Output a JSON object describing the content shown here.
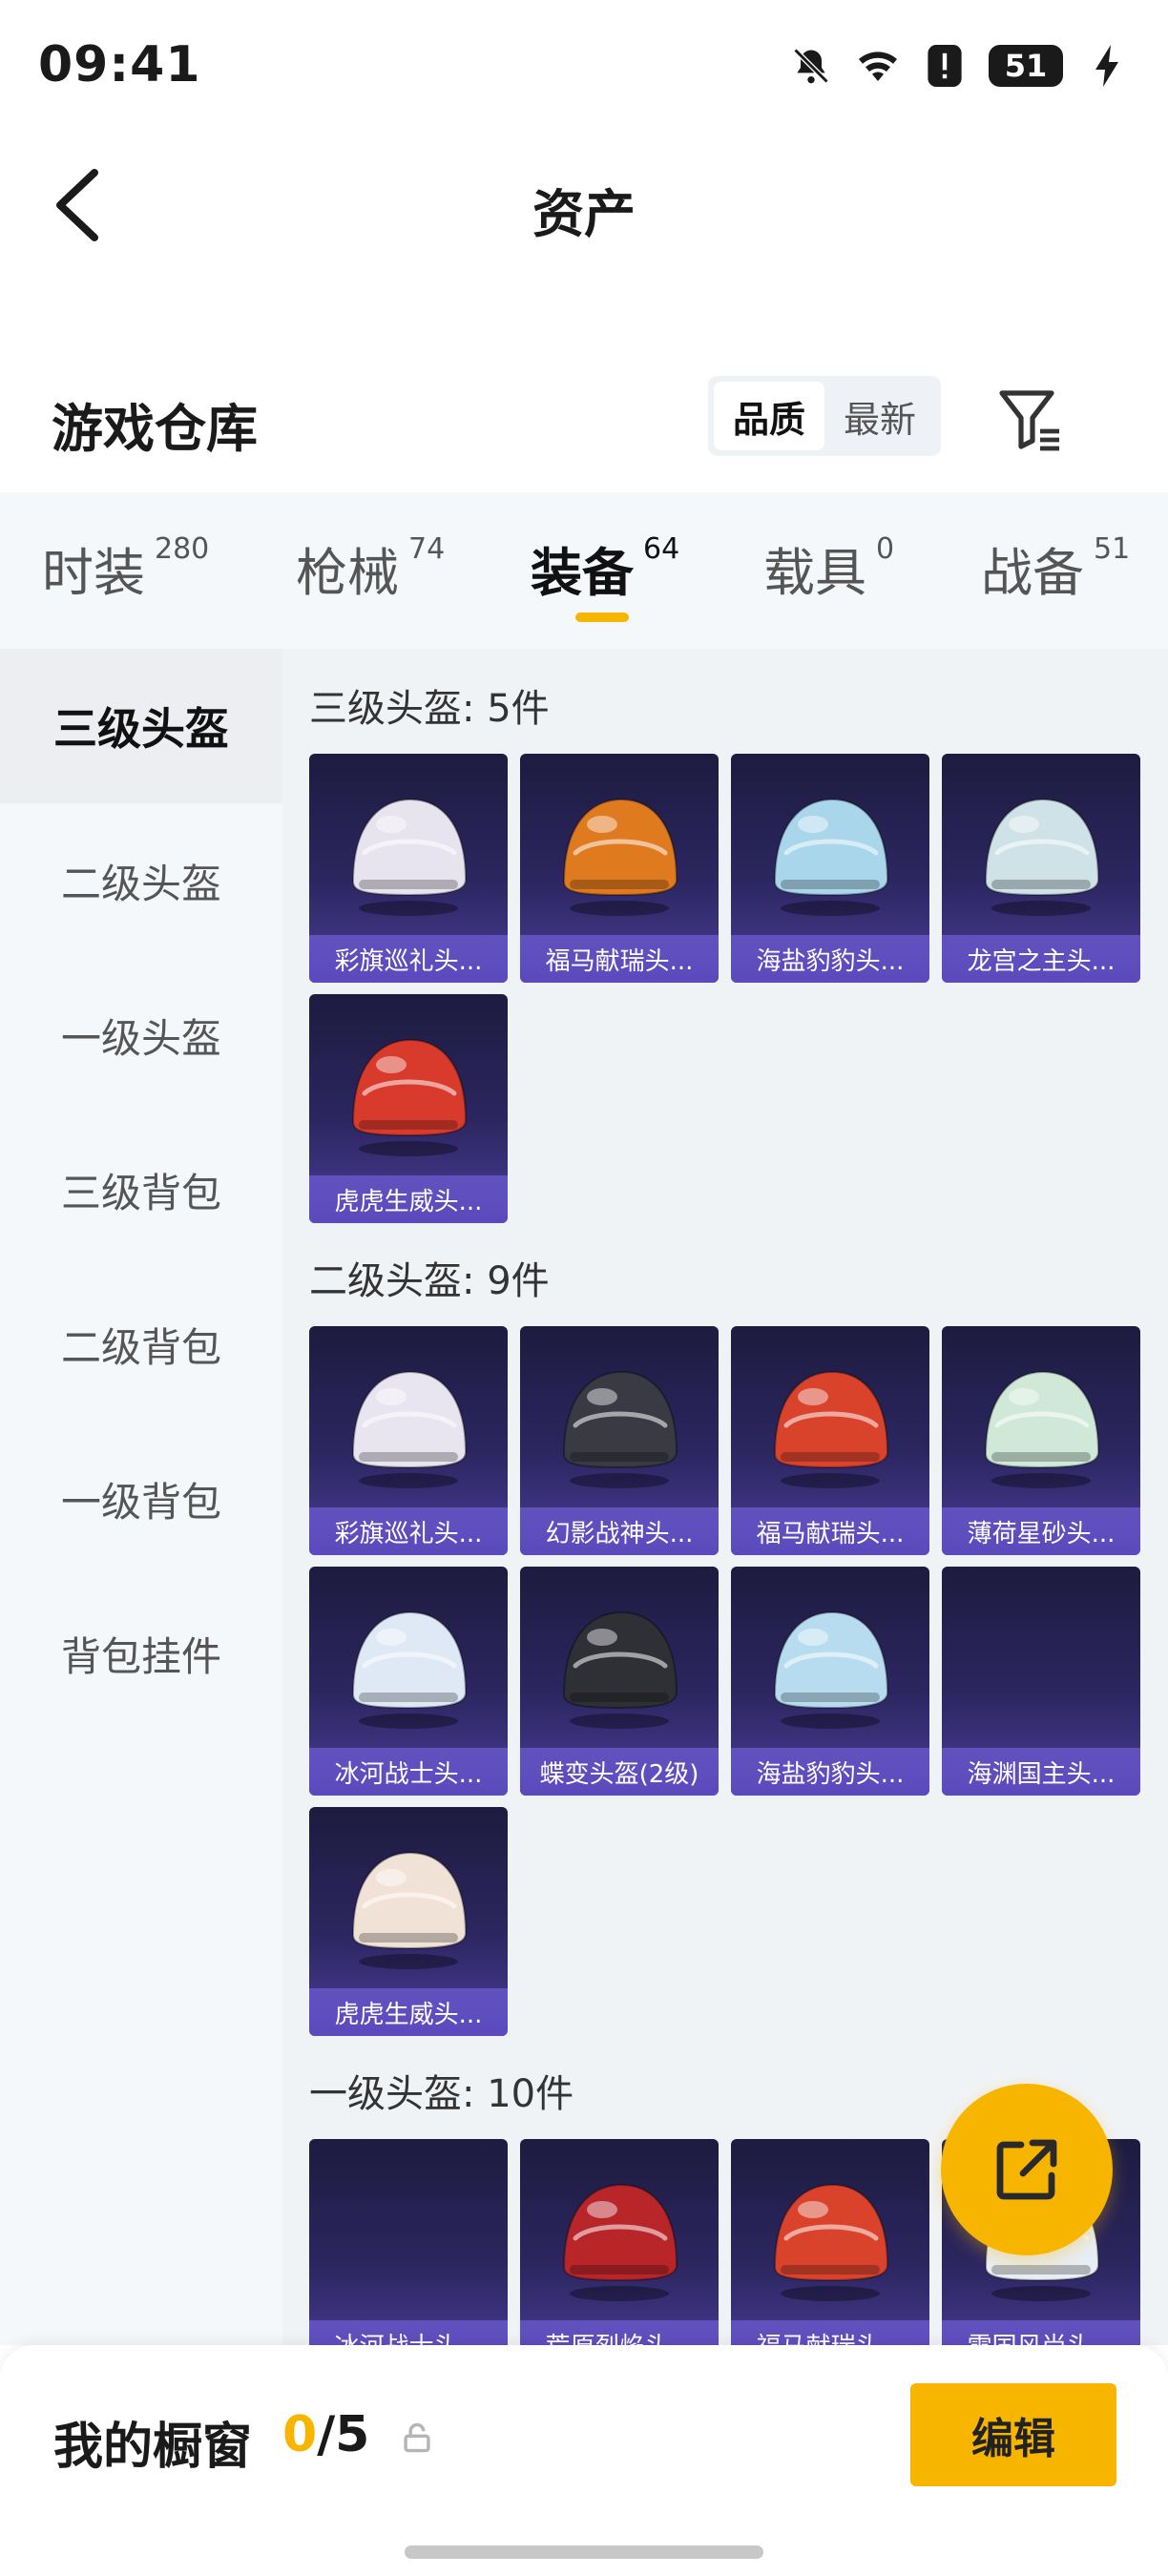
{
  "status_bar": {
    "time": "09:41",
    "battery": "51"
  },
  "header": {
    "title": "资产"
  },
  "warehouse": {
    "title": "游戏仓库",
    "sort_options": [
      "品质",
      "最新"
    ],
    "active_sort": "品质"
  },
  "tabs": [
    {
      "label": "时装",
      "count": "280"
    },
    {
      "label": "枪械",
      "count": "74"
    },
    {
      "label": "装备",
      "count": "64"
    },
    {
      "label": "载具",
      "count": "0"
    },
    {
      "label": "战备",
      "count": "51"
    }
  ],
  "active_tab": "装备",
  "sidebar": {
    "items": [
      "三级头盔",
      "二级头盔",
      "一级头盔",
      "三级背包",
      "二级背包",
      "一级背包",
      "背包挂件"
    ],
    "active": "三级头盔"
  },
  "sections": [
    {
      "title": "三级头盔: 5件",
      "items": [
        {
          "name": "彩旗巡礼头...",
          "icon": "helmet-flag-icon",
          "color": "#e8e4ef"
        },
        {
          "name": "福马献瑞头...",
          "icon": "helmet-horse-icon",
          "color": "#e07a1f"
        },
        {
          "name": "海盐豹豹头...",
          "icon": "helmet-seal-icon",
          "color": "#a9d6ea"
        },
        {
          "name": "龙宫之主头...",
          "icon": "helmet-dragon-icon",
          "color": "#cfe2e8"
        },
        {
          "name": "虎虎生威头...",
          "icon": "helmet-tiger-icon",
          "color": "#d83a2c"
        }
      ]
    },
    {
      "title": "二级头盔: 9件",
      "items": [
        {
          "name": "彩旗巡礼头...",
          "icon": "helmet-flag-icon",
          "color": "#e9e5f0"
        },
        {
          "name": "幻影战神头...",
          "icon": "helmet-phantom-icon",
          "color": "#3a3a44"
        },
        {
          "name": "福马献瑞头...",
          "icon": "helmet-horse-icon",
          "color": "#d9432c"
        },
        {
          "name": "薄荷星砂头...",
          "icon": "helmet-mint-icon",
          "color": "#cfe8d8"
        },
        {
          "name": "冰河战士头...",
          "icon": "helmet-glacier-icon",
          "color": "#dfe9f5"
        },
        {
          "name": "蝶变头盔(2级)",
          "icon": "helmet-butterfly-icon",
          "color": "#2f2f36"
        },
        {
          "name": "海盐豹豹头...",
          "icon": "helmet-seal-icon",
          "color": "#b8dcef"
        },
        {
          "name": "海渊国主头...",
          "icon": "helmet-abyss-icon",
          "color": ""
        },
        {
          "name": "虎虎生威头...",
          "icon": "helmet-tiger-icon",
          "color": "#f1e2d8"
        }
      ]
    },
    {
      "title": "一级头盔: 10件",
      "items": [
        {
          "name": "冰河战士头...",
          "icon": "helmet-glacier-icon",
          "color": ""
        },
        {
          "name": "荒原烈焰头...",
          "icon": "helmet-flame-icon",
          "color": "#b8262a"
        },
        {
          "name": "福马献瑞头...",
          "icon": "helmet-horse-icon",
          "color": "#d9432c"
        },
        {
          "name": "雪国风尚头...",
          "icon": "helmet-snow-icon",
          "color": "#e8eef5"
        }
      ]
    }
  ],
  "showcase": {
    "label": "我的橱窗",
    "current": "0",
    "total": "/5",
    "edit_label": "编辑"
  },
  "colors": {
    "accent": "#f7b500",
    "card_bg": "#2c2660"
  }
}
